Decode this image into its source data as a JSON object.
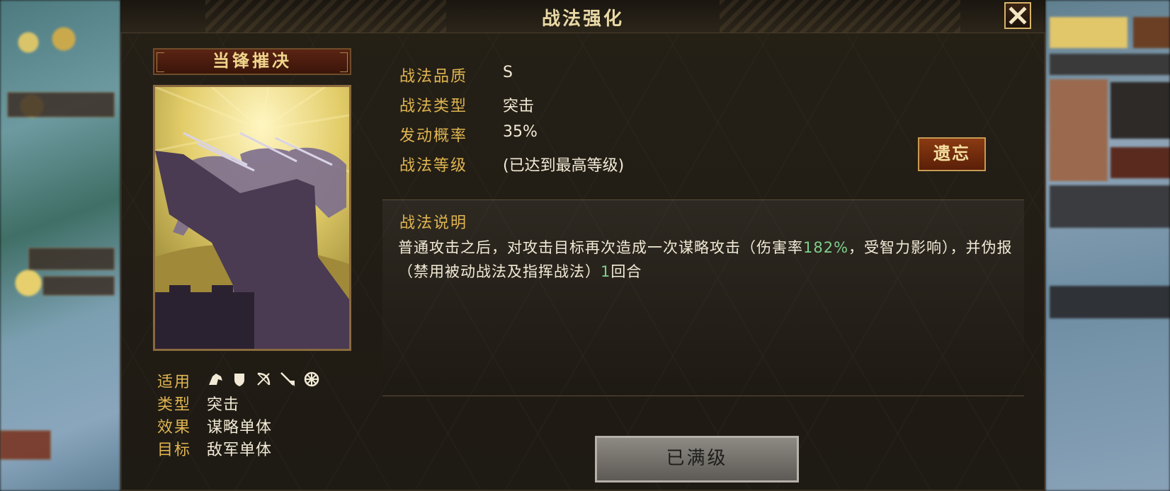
{
  "dialog": {
    "title": "战法强化",
    "close_icon": "close-icon"
  },
  "skill": {
    "name": "当锋摧决",
    "card_art": "cavalry-charge-illustration",
    "attributes": {
      "applicable_label": "适用",
      "applicable_icons": [
        "cavalry-icon",
        "shield-icon",
        "bow-icon",
        "spear-icon",
        "siege-icon"
      ],
      "type_label": "类型",
      "type_value": "突击",
      "effect_label": "效果",
      "effect_value": "谋略单体",
      "target_label": "目标",
      "target_value": "敌军单体"
    }
  },
  "info": {
    "quality_label": "战法品质",
    "quality_value": "S",
    "type_label": "战法类型",
    "type_value": "突击",
    "rate_label": "发动概率",
    "rate_value": "35%",
    "level_label": "战法等级",
    "level_value": "(已达到最高等级)"
  },
  "forget_button": "遗忘",
  "description": {
    "title": "战法说明",
    "p1": "普通攻击之后，对攻击目标再次造成一次谋略攻击（伤害率",
    "p1_highlight": "182%",
    "p2": "，受智力影响），并伪报（禁用被动战法及指挥战法）",
    "p2_highlight": "1",
    "p3": "回合"
  },
  "maxed_button": "已满级",
  "colors": {
    "gold_label": "#e0b551",
    "highlight_green": "#7fcf8c",
    "text": "#f2ead6"
  }
}
